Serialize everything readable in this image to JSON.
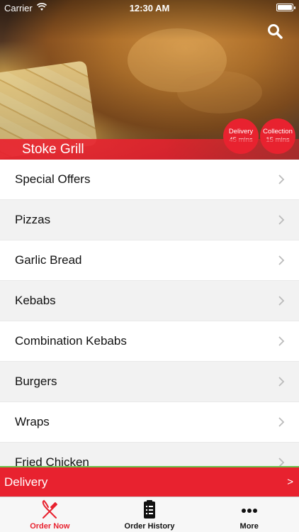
{
  "status_bar": {
    "carrier": "Carrier",
    "time": "12:30 AM"
  },
  "restaurant": {
    "name": "Stoke Grill"
  },
  "badges": {
    "delivery": {
      "label": "Delivery",
      "value": "45 mins"
    },
    "collection": {
      "label": "Collection",
      "value": "15 mins"
    }
  },
  "menu": {
    "items": [
      {
        "label": "Special Offers"
      },
      {
        "label": "Pizzas"
      },
      {
        "label": "Garlic Bread"
      },
      {
        "label": "Kebabs"
      },
      {
        "label": "Combination Kebabs"
      },
      {
        "label": "Burgers"
      },
      {
        "label": "Wraps"
      },
      {
        "label": "Fried Chicken"
      }
    ]
  },
  "order_mode": {
    "label": "Delivery",
    "arrow": ">"
  },
  "tabs": [
    {
      "label": "Order Now",
      "icon": "fork-knife-icon"
    },
    {
      "label": "Order History",
      "icon": "clipboard-list-icon"
    },
    {
      "label": "More",
      "icon": "more-dots-icon"
    }
  ],
  "colors": {
    "accent": "#e8222f",
    "tab_active": "#e8222f",
    "divider_green": "#6cc04a"
  }
}
